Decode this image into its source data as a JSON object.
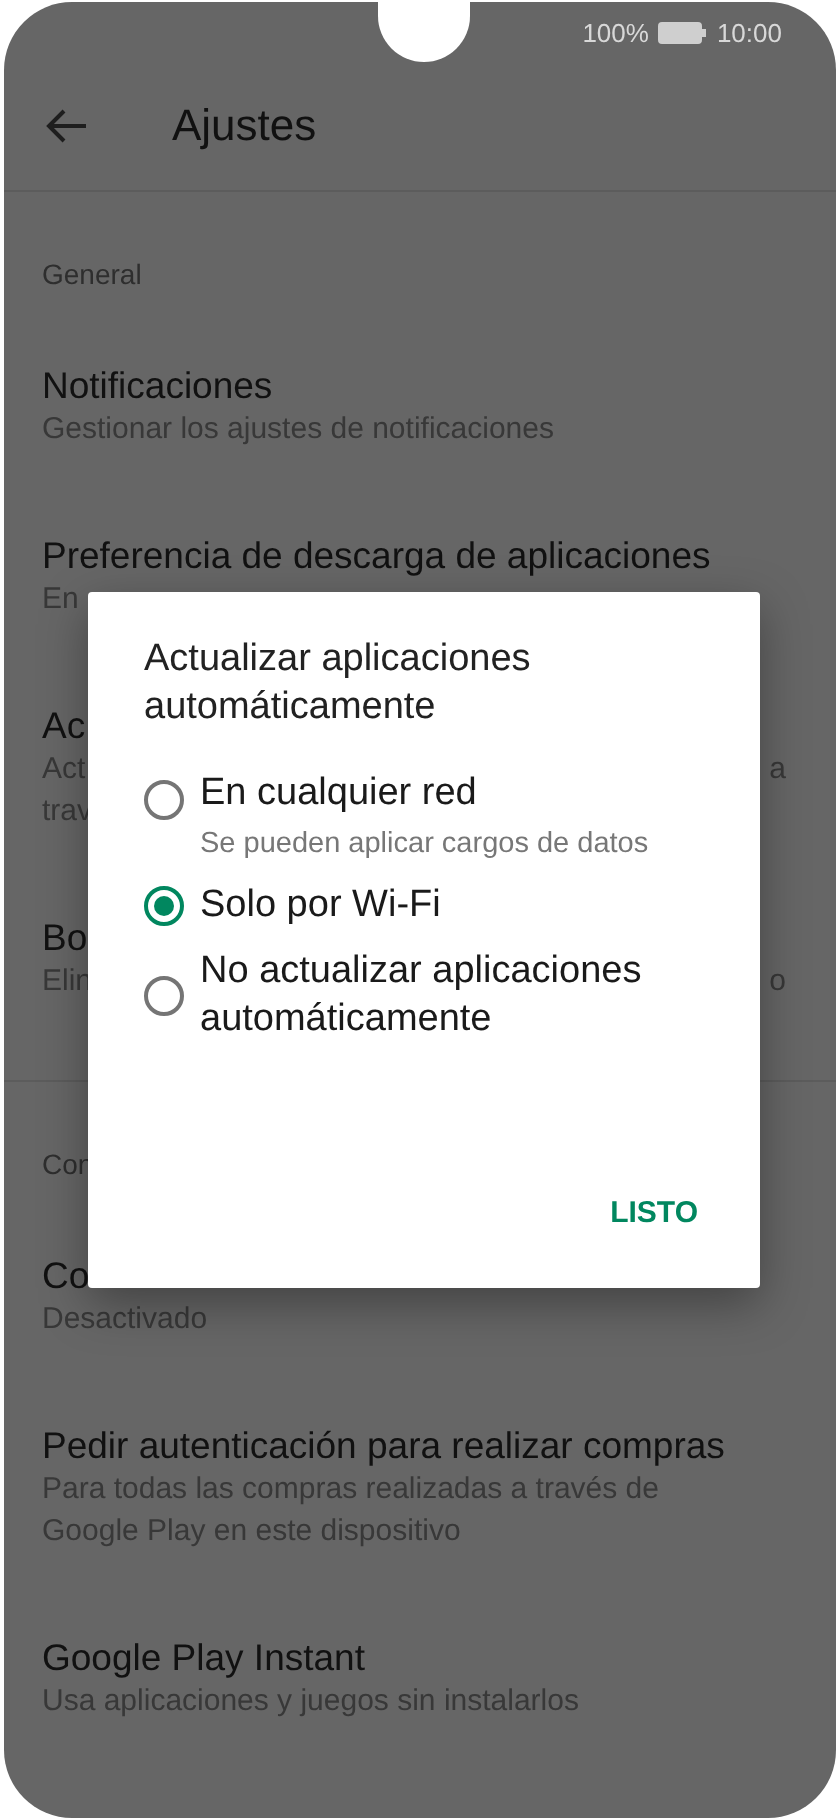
{
  "status_bar": {
    "battery": "100%",
    "time": "10:00"
  },
  "header": {
    "title": "Ajustes"
  },
  "sections": [
    {
      "heading": "General",
      "rows": [
        {
          "title": "Notificaciones",
          "subtitle": [
            "Gestionar los ajustes de notificaciones"
          ]
        },
        {
          "title": "Preferencia de descarga de aplicaciones",
          "subtitle": [
            "En"
          ]
        },
        {
          "title": "Ac",
          "subtitle": [
            "Act",
            "trav"
          ],
          "subtitle_end": "a"
        },
        {
          "title": "Bo",
          "subtitle": [
            "Elin"
          ],
          "subtitle_end": "o"
        }
      ]
    },
    {
      "heading": "Con",
      "rows": [
        {
          "title": "Co",
          "subtitle": [
            "Desactivado"
          ]
        },
        {
          "title": "Pedir autenticación para realizar compras",
          "subtitle": [
            "Para todas las compras realizadas a través de",
            "Google Play en este dispositivo"
          ]
        },
        {
          "title": "Google Play Instant",
          "subtitle": [
            "Usa aplicaciones y juegos sin instalarlos"
          ]
        }
      ]
    }
  ],
  "dialog": {
    "title": "Actualizar aplicaciones automáticamente",
    "options": [
      {
        "label": "En cualquier red",
        "hint": "Se pueden aplicar cargos de datos",
        "selected": false
      },
      {
        "label": "Solo por Wi-Fi",
        "selected": true
      },
      {
        "label": "No actualizar aplicaciones automáticamente",
        "selected": false
      }
    ],
    "button": "LISTO"
  }
}
